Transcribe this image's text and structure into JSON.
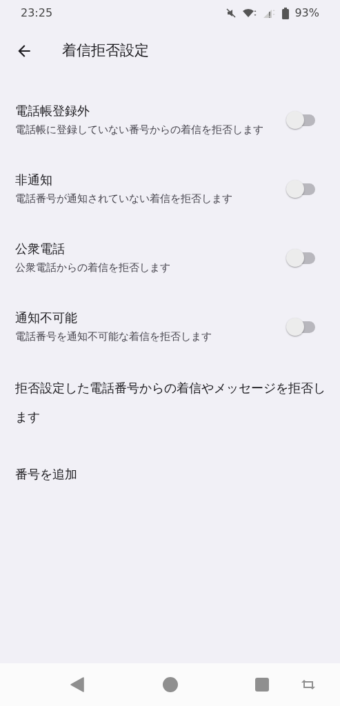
{
  "status_bar": {
    "time": "23:25",
    "battery": "93%"
  },
  "header": {
    "title": "着信拒否設定"
  },
  "settings": [
    {
      "title": "電話帳登録外",
      "description": "電話帳に登録していない番号からの着信を拒否します",
      "on": false
    },
    {
      "title": "非通知",
      "description": "電話番号が通知されていない着信を拒否します",
      "on": false
    },
    {
      "title": "公衆電話",
      "description": "公衆電話からの着信を拒否します",
      "on": false
    },
    {
      "title": "通知不可能",
      "description": "電話番号を通知不可能な着信を拒否します",
      "on": false
    }
  ],
  "info_text": "拒否設定した電話番号からの着信やメッセージを拒否します",
  "add_number": "番号を追加"
}
